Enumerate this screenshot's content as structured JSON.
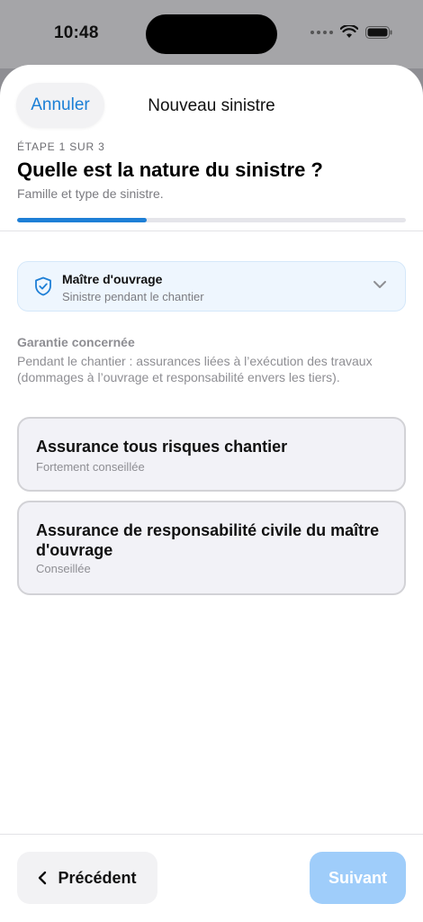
{
  "status_bar": {
    "time": "10:48"
  },
  "header": {
    "cancel_label": "Annuler",
    "title": "Nouveau sinistre"
  },
  "step": {
    "indicator": "ÉTAPE 1 SUR 3",
    "question": "Quelle est la nature du sinistre ?",
    "subtitle": "Famille et type de sinistre.",
    "progress": 0.3333
  },
  "role_selector": {
    "title": "Maître d'ouvrage",
    "subtitle": "Sinistre pendant le chantier",
    "icon": "shield-check-icon"
  },
  "guarantee": {
    "label": "Garantie concernée",
    "description": "Pendant le chantier : assurances liées à l’exécution des travaux (dommages à l’ouvrage et responsabilité envers les tiers)."
  },
  "options": [
    {
      "title": "Assurance tous risques chantier",
      "subtitle": "Fortement conseillée"
    },
    {
      "title": "Assurance de responsabilité civile du maître d'ouvrage",
      "subtitle": "Conseillée"
    }
  ],
  "footer": {
    "prev_label": "Précédent",
    "next_label": "Suivant"
  },
  "colors": {
    "accent": "#1e7fd6",
    "next_disabled": "#9fcdfa",
    "role_bg": "#eef6fe"
  }
}
